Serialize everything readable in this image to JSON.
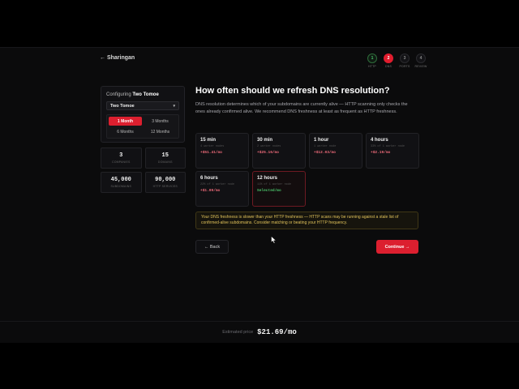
{
  "nav": {
    "back_label": "← Sharingan"
  },
  "stepper": {
    "steps": [
      {
        "num": "1",
        "label": "HTTP",
        "state": "done"
      },
      {
        "num": "2",
        "label": "DNS",
        "state": "active"
      },
      {
        "num": "3",
        "label": "PORTS",
        "state": "todo"
      },
      {
        "num": "4",
        "label": "REVIEW",
        "state": "todo"
      }
    ]
  },
  "config": {
    "prefix": "Configuring",
    "company": "Two Tomoe",
    "select_value": "Two Tomoe",
    "periods": [
      {
        "label": "1 Month",
        "selected": true
      },
      {
        "label": "3 Months",
        "selected": false
      },
      {
        "label": "6 Months",
        "selected": false
      },
      {
        "label": "12 Months",
        "selected": false
      }
    ]
  },
  "stats": [
    {
      "value": "3",
      "caption": "COMPANIES"
    },
    {
      "value": "15",
      "caption": "DOMAINS"
    },
    {
      "value": "45,000",
      "caption": "SUBDOMAINS"
    },
    {
      "value": "90,000",
      "caption": "HTTP SERVICES"
    }
  ],
  "main": {
    "title": "How often should we refresh DNS resolution?",
    "description": "DNS resolution determines which of your subdomains are currently alive — HTTP scanning only checks the ones already confirmed alive. We recommend DNS freshness at least as frequent as HTTP freshness."
  },
  "options": [
    {
      "title": "15 min",
      "sub": "4 worker nodes",
      "price": "+$51.41/mo",
      "selected": false
    },
    {
      "title": "30 min",
      "sub": "2 worker nodes",
      "price": "+$25.16/mo",
      "selected": false
    },
    {
      "title": "1 hour",
      "sub": "1 worker node",
      "price": "+$12.03/mo",
      "selected": false
    },
    {
      "title": "4 hours",
      "sub": "33% of 1 worker node",
      "price": "+$2.19/mo",
      "selected": false
    },
    {
      "title": "6 hours",
      "sub": "22% of 1 worker node",
      "price": "+$1.09/mo",
      "selected": false
    },
    {
      "title": "12 hours",
      "sub": "11% of 1 worker node",
      "price": "Selected/mo",
      "selected": true
    }
  ],
  "warning": "Your DNS freshness is slower than your HTTP freshness — HTTP scans may be running against a stale list of confirmed-alive subdomains. Consider matching or beating your HTTP frequency.",
  "buttons": {
    "back": "← Back",
    "continue": "Continue →"
  },
  "footer": {
    "label": "Estimated price",
    "value": "$21.69/mo"
  },
  "colors": {
    "accent": "#dc1f2f",
    "success": "#4ac46a",
    "warning": "#e0c25a",
    "price": "#ef6b7a"
  },
  "icons": {
    "select_caret": "chevron-down-icon",
    "cursor": "mouse-pointer-icon"
  }
}
